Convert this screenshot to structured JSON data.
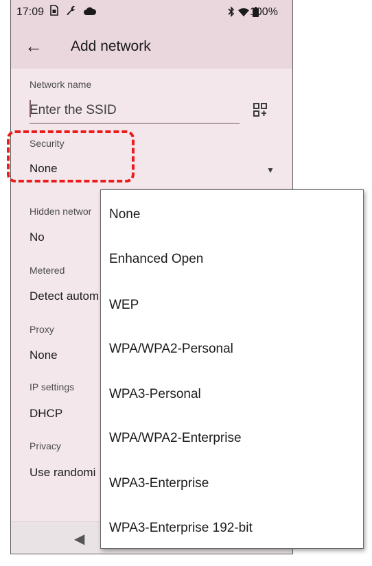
{
  "status_bar": {
    "time": "17:09",
    "left_icons": [
      "sim-icon",
      "wrench-icon",
      "cloud-icon"
    ],
    "right_icons": [
      "bluetooth-icon",
      "wifi-icon",
      "battery-icon"
    ],
    "battery": "100%"
  },
  "app_bar": {
    "title": "Add network"
  },
  "form": {
    "network_name_label": "Network name",
    "ssid_placeholder": "Enter the SSID",
    "security_label": "Security",
    "security_value": "None",
    "hidden_label": "Hidden networ",
    "hidden_value": "No",
    "metered_label": "Metered",
    "metered_value": "Detect autom",
    "proxy_label": "Proxy",
    "proxy_value": "None",
    "ip_label": "IP settings",
    "ip_value": "DHCP",
    "privacy_label": "Privacy",
    "privacy_value": "Use randomi"
  },
  "security_menu": {
    "options": [
      "None",
      "Enhanced Open",
      "WEP",
      "WPA/WPA2-Personal",
      "WPA3-Personal",
      "WPA/WPA2-Enterprise",
      "WPA3-Enterprise",
      "WPA3-Enterprise 192-bit"
    ]
  },
  "colors": {
    "background": "#f3e7ec",
    "app_bar": "#ead6dd",
    "highlight": "#ea1c1c",
    "input_underline": "#6f4f59"
  }
}
